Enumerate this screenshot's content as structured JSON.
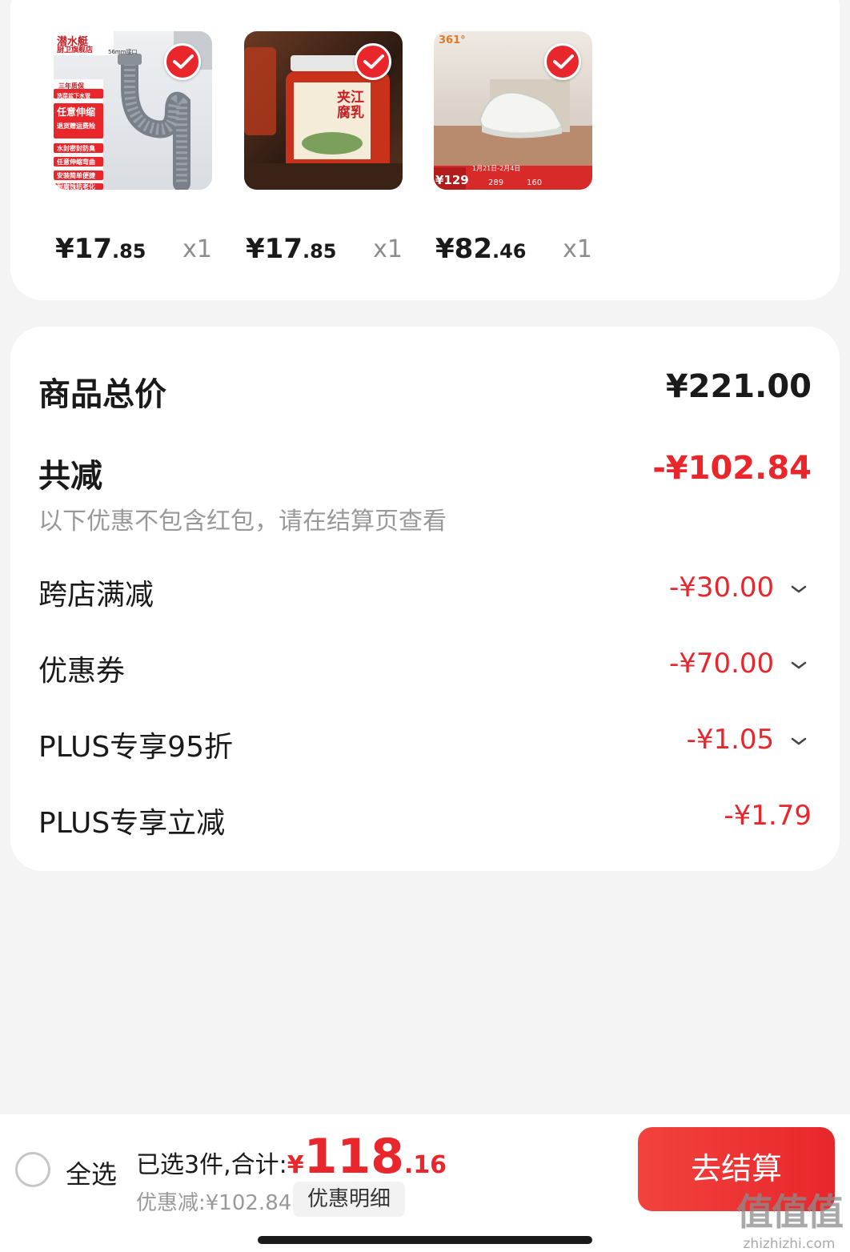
{
  "products": [
    {
      "image_title": "潜水艇",
      "image_subtitle": "厨卫旗舰店",
      "image_badge": "三年质保",
      "image_caption": "56mm接口",
      "image_lines": [
        "洗菜盆下水管",
        "任意伸缩",
        "退货赠运费险",
        "水封密封防臭",
        "任意伸缩弯曲",
        "安装简单便捷",
        "耐腐蚀抗老化"
      ],
      "price_yen": "¥17",
      "price_decimal": ".85",
      "quantity": "x1",
      "icon": "drain-pipe"
    },
    {
      "image_title": "夹江腐乳",
      "price_yen": "¥17",
      "price_decimal": ".85",
      "quantity": "x1",
      "icon": "fermented-tofu-jar"
    },
    {
      "image_brand": "361°",
      "image_promo_price": "¥129",
      "image_promo_dates": "1月21日-2月4日",
      "image_prices": [
        "289",
        "160"
      ],
      "price_yen": "¥82",
      "price_decimal": ".46",
      "quantity": "x1",
      "icon": "sneaker"
    }
  ],
  "summary": {
    "total_label": "商品总价",
    "total_value": "¥221.00",
    "reduction_label": "共减",
    "reduction_value": "-¥102.84",
    "note": "以下优惠不包含红包，请在结算页查看",
    "items": [
      {
        "label": "跨店满减",
        "value": "-¥30.00",
        "expandable": true
      },
      {
        "label": "优惠券",
        "value": "-¥70.00",
        "expandable": true
      },
      {
        "label": "PLUS专享95折",
        "value": "-¥1.05",
        "expandable": true
      },
      {
        "label": "PLUS专享立减",
        "value": "-¥1.79",
        "expandable": false
      }
    ]
  },
  "bottom_bar": {
    "select_all": "全选",
    "selected_prefix": "已选3件,合计:",
    "total_yen": "¥",
    "total_int": "118",
    "total_dec": ".16",
    "saved": "优惠减:¥102.84",
    "discount_detail": "优惠明细",
    "checkout": "去结算",
    "watermark_big": "值值值",
    "watermark_small": "zhizhizhi.com"
  },
  "colors": {
    "accent": "#e8262b",
    "background": "#f4f4f4",
    "card": "#ffffff",
    "muted": "#999999"
  }
}
